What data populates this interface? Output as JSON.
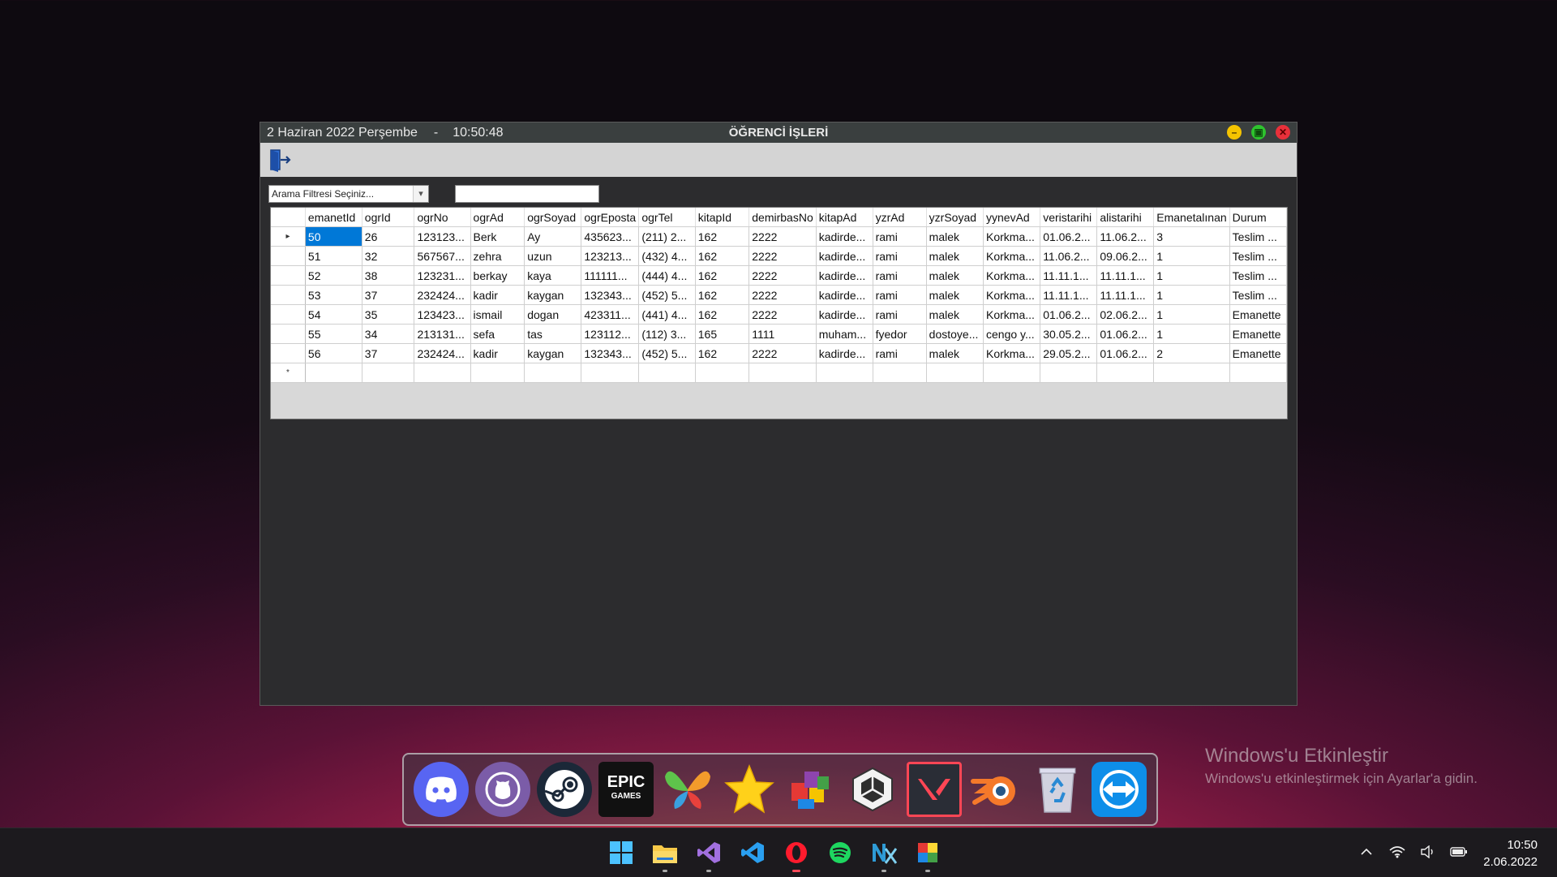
{
  "window": {
    "date_text": "2 Haziran 2022 Perşembe",
    "separator": "-",
    "time_text": "10:50:48",
    "title": "ÖĞRENCİ İŞLERİ"
  },
  "toolbar": {
    "exit_icon": "exit-door-icon"
  },
  "filter": {
    "select_value": "Arama Filtresi Seçiniz...",
    "search_value": ""
  },
  "grid": {
    "columns": [
      "emanetId",
      "ogrId",
      "ogrNo",
      "ogrAd",
      "ogrSoyad",
      "ogrEposta",
      "ogrTel",
      "kitapId",
      "demirbasNo",
      "kitapAd",
      "yzrAd",
      "yzrSoyad",
      "yynevAd",
      "veristarihi",
      "alistarihi",
      "Emanetalınan",
      "Durum"
    ],
    "rows": [
      [
        "50",
        "26",
        "123123...",
        "Berk",
        "Ay",
        "435623...",
        "(211) 2...",
        "162",
        "2222",
        "kadirde...",
        "rami",
        "malek",
        "Korkma...",
        "01.06.2...",
        "11.06.2...",
        "3",
        "Teslim ..."
      ],
      [
        "51",
        "32",
        "567567...",
        "zehra",
        "uzun",
        "123213...",
        "(432) 4...",
        "162",
        "2222",
        "kadirde...",
        "rami",
        "malek",
        "Korkma...",
        "11.06.2...",
        "09.06.2...",
        "1",
        "Teslim ..."
      ],
      [
        "52",
        "38",
        "123231...",
        "berkay",
        "kaya",
        "111111...",
        "(444) 4...",
        "162",
        "2222",
        "kadirde...",
        "rami",
        "malek",
        "Korkma...",
        "11.11.1...",
        "11.11.1...",
        "1",
        "Teslim ..."
      ],
      [
        "53",
        "37",
        "232424...",
        "kadir",
        "kaygan",
        "132343...",
        "(452) 5...",
        "162",
        "2222",
        "kadirde...",
        "rami",
        "malek",
        "Korkma...",
        "11.11.1...",
        "11.11.1...",
        "1",
        "Teslim ..."
      ],
      [
        "54",
        "35",
        "123423...",
        "ismail",
        "dogan",
        "423311...",
        "(441) 4...",
        "162",
        "2222",
        "kadirde...",
        "rami",
        "malek",
        "Korkma...",
        "01.06.2...",
        "02.06.2...",
        "1",
        "Emanette"
      ],
      [
        "55",
        "34",
        "213131...",
        "sefa",
        "tas",
        "123112...",
        "(112) 3...",
        "165",
        "1111",
        "muham...",
        "fyedor",
        "dostoye...",
        "cengo y...",
        "30.05.2...",
        "01.06.2...",
        "1",
        "Emanette"
      ],
      [
        "56",
        "37",
        "232424...",
        "kadir",
        "kaygan",
        "132343...",
        "(452) 5...",
        "162",
        "2222",
        "kadirde...",
        "rami",
        "malek",
        "Korkma...",
        "29.05.2...",
        "01.06.2...",
        "2",
        "Emanette"
      ]
    ],
    "current_row_marker": "▸",
    "new_row_marker": "*"
  },
  "watermark": {
    "title": "Windows'u Etkinleştir",
    "subtitle": "Windows'u etkinleştirmek için Ayarlar'a gidin."
  },
  "dock": {
    "epic_text_1": "EPIC",
    "epic_text_2": "GAMES",
    "icons": [
      "discord-icon",
      "github-icon",
      "steam-icon",
      "epic-games-icon",
      "butterfly-icon",
      "star-icon",
      "blocks-icon",
      "unity-icon",
      "valorant-icon",
      "blender-icon",
      "recycle-bin-icon",
      "teamviewer-icon"
    ]
  },
  "taskbar": {
    "icons": [
      "windows-start-icon",
      "file-explorer-icon",
      "visual-studio-icon",
      "vscode-icon",
      "opera-icon",
      "spotify-icon",
      "nx-icon",
      "color-palette-icon"
    ],
    "clock_time": "10:50",
    "clock_date": "2.06.2022"
  }
}
